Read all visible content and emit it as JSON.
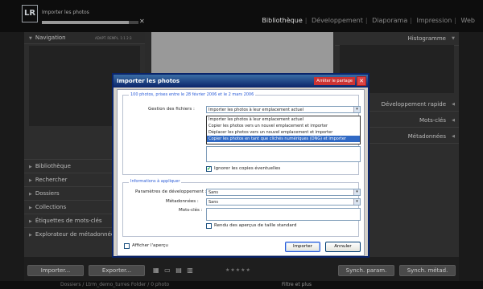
{
  "topbar": {
    "logo": "LR",
    "import_status": "Importer les photos",
    "import_cancel": "✕",
    "import_progress": 0.9,
    "modules": [
      "Bibliothèque",
      "Développement",
      "Diaporama",
      "Impression",
      "Web"
    ],
    "active_module": "Bibliothèque"
  },
  "left_panel": {
    "navigation_title": "Navigation",
    "zoom_options": [
      "ADAPT.",
      "REMPL.",
      "1:1",
      "2:3"
    ],
    "collections": [
      "Bibliothèque",
      "Rechercher",
      "Dossiers",
      "Collections",
      "Étiquettes de mots-clés",
      "Explorateur de métadonnées"
    ]
  },
  "right_panel": {
    "histogram_title": "Histogramme",
    "sections": [
      "Développement rapide",
      "Mots-clés",
      "Métadonnées"
    ]
  },
  "toolbar": {
    "import_label": "Importer...",
    "export_label": "Exporter...",
    "sync_params_label": "Synch. param.",
    "sync_meta_label": "Synch. métad.",
    "stars": "★★★★★"
  },
  "filmbar": {
    "path": "Dossiers / Ltrm_demo_turres Folder / 0 photo",
    "filter_label": "Filtre",
    "filter_value": "et plus"
  },
  "dialog": {
    "title": "Importer les photos",
    "close_label": "✕",
    "tooltip": "Arrêter le partage",
    "summary": "100 photos, prises entre le 28 février 2006 et le 2 mars 2006",
    "file_handling_label": "Gestion des fichiers :",
    "file_handling_value": "Importer les photos à leur emplacement actuel",
    "options": [
      "Importer les photos à leur emplacement actuel",
      "Copier les photos vers un nouvel emplacement et importer",
      "Déplacer les photos vers un nouvel emplacement et importer",
      "Copier les photos en tant que clichés numériques (DNG) et importer"
    ],
    "selected_option_index": 3,
    "ignore_duplicates_label": "Ignorer les copies éventuelles",
    "ignore_duplicates_checked": true,
    "apply_group_title": "Informations à appliquer",
    "dev_settings_label": "Paramètres de développement :",
    "dev_settings_value": "Sans",
    "metadata_label": "Métadonnées :",
    "metadata_value": "Sans",
    "keywords_label": "Mots-clés :",
    "standard_previews_label": "Rendu des aperçus de taille standard",
    "standard_previews_checked": false,
    "show_preview_label": "Afficher l'aperçu",
    "show_preview_checked": false,
    "import_button": "Importer",
    "cancel_button": "Annuler"
  }
}
